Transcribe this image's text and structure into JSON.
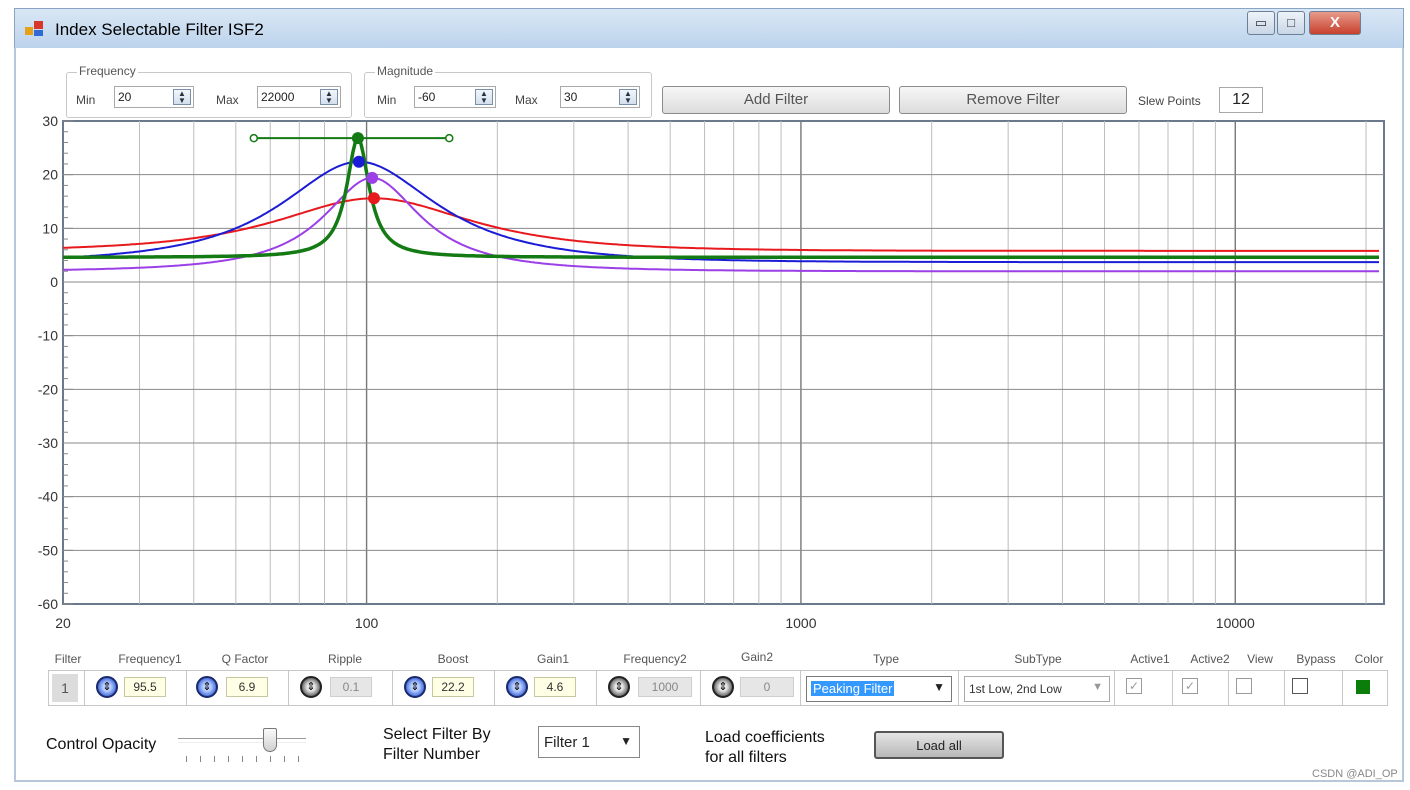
{
  "window": {
    "title": "Index Selectable Filter ISF2",
    "minimize_glyph": "▭",
    "maximize_glyph": "□",
    "close_glyph": "X"
  },
  "frequency_group": {
    "title": "Frequency",
    "min_label": "Min",
    "min_value": "20",
    "max_label": "Max",
    "max_value": "22000"
  },
  "magnitude_group": {
    "title": "Magnitude",
    "min_label": "Min",
    "min_value": "-60",
    "max_label": "Max",
    "max_value": "30"
  },
  "toolbar": {
    "add_filter": "Add Filter",
    "remove_filter": "Remove Filter",
    "slew_points_label": "Slew Points",
    "slew_points_value": "12"
  },
  "chart_data": {
    "type": "line",
    "x_scale": "log",
    "xlim": [
      20,
      22000
    ],
    "ylim": [
      -60,
      30
    ],
    "x_ticks": [
      "20",
      "100",
      "1000",
      "10000"
    ],
    "y_ticks": [
      "30",
      "20",
      "10",
      "0",
      "-10",
      "-20",
      "-30",
      "-40",
      "-50",
      "-60"
    ],
    "grid": true,
    "series": [
      {
        "color": "#e8191c",
        "baseline": 5.8,
        "center": 104,
        "peak": 15.6,
        "q": 0.8,
        "width": 2
      },
      {
        "color": "#9b3fe6",
        "baseline": 2.0,
        "center": 103,
        "peak": 19.4,
        "q": 1.6,
        "width": 2
      },
      {
        "color": "#1c1cd6",
        "baseline": 3.7,
        "center": 96,
        "peak": 22.4,
        "q": 1.0,
        "width": 2
      },
      {
        "color": "#147a14",
        "baseline": 4.6,
        "center": 95.5,
        "peak": 26.8,
        "q": 6.9,
        "width": 3.5
      }
    ],
    "handles": [
      {
        "color": "#e8191c",
        "x": 104,
        "y": 15.6
      },
      {
        "color": "#9b3fe6",
        "x": 103,
        "y": 19.4
      },
      {
        "color": "#1c1cd6",
        "x": 96,
        "y": 22.4
      },
      {
        "color": "#147a14",
        "x": 95.5,
        "y": 26.8
      }
    ],
    "bandwidth_handle": {
      "color": "#147a14",
      "x_low": 55,
      "x_high": 155,
      "y": 26.8
    }
  },
  "filter_table": {
    "headers": {
      "filter": "Filter",
      "frequency1": "Frequency1",
      "q_factor": "Q Factor",
      "ripple": "Ripple",
      "boost": "Boost",
      "gain1": "Gain1",
      "frequency2": "Frequency2",
      "gain2": "Gain2",
      "type": "Type",
      "subtype": "SubType",
      "active1": "Active1",
      "active2": "Active2",
      "view": "View",
      "bypass": "Bypass",
      "color": "Color"
    },
    "row": {
      "filter_number": "1",
      "frequency1": "95.5",
      "q_factor": "6.9",
      "ripple": "0.1",
      "boost": "22.2",
      "gain1": "4.6",
      "frequency2": "1000",
      "gain2": "0",
      "type": "Peaking Filter",
      "subtype": "1st Low, 2nd Low",
      "color": "#0a7d0a"
    }
  },
  "bottom": {
    "control_opacity_label": "Control Opacity",
    "opacity_level": 0.72,
    "select_filter_line1": "Select Filter By",
    "select_filter_line2": "Filter Number",
    "filter_select_value": "Filter 1",
    "load_coeff_line1": "Load coefficients",
    "load_coeff_line2": "for all filters",
    "load_all": "Load all"
  },
  "watermark": "CSDN @ADI_OP"
}
